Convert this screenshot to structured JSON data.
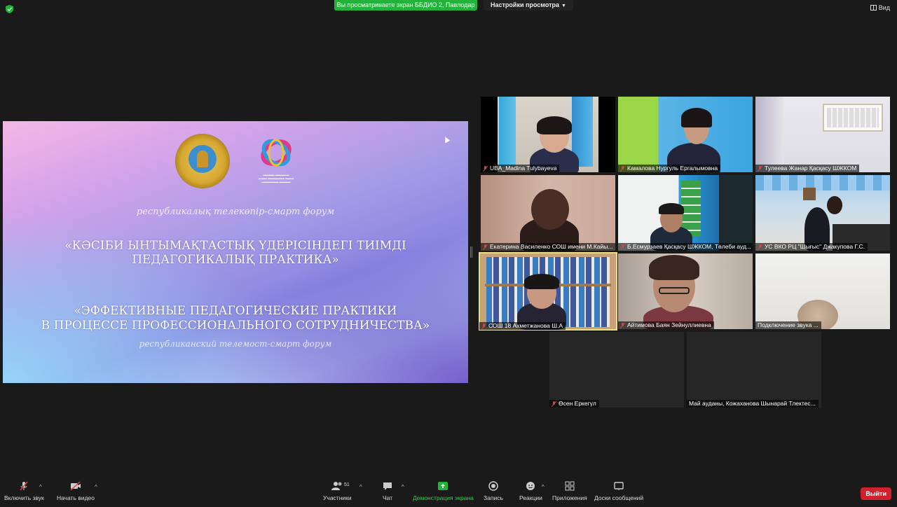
{
  "top": {
    "share_banner": "Вы просматриваете экран ББДИО 2, Павлодар",
    "view_settings": "Настройки просмотра",
    "view_toggle": "Вид"
  },
  "slide": {
    "kz_subtitle": "республикалық телекөпір-смарт форум",
    "kz_title_line1": "«КӘСІБИ ЫНТЫМАҚТАСТЫҚ ҮДЕРІСІНДЕГІ ТИІМДІ",
    "kz_title_line2": "ПЕДАГОГИКАЛЫҚ ПРАКТИКА»",
    "ru_title_line1": "«ЭФФЕКТИВНЫЕ ПЕДАГОГИЧЕСКИЕ ПРАКТИКИ",
    "ru_title_line2": "В ПРОЦЕССЕ ПРОФЕССИОНАЛЬНОГО СОТРУДНИЧЕСТВА»",
    "ru_subtitle": "республиканский телемост-смарт форум"
  },
  "participants": [
    {
      "name": "UBA_Madina Tulybayeva",
      "muted": true
    },
    {
      "name": "Камалова Нургуль Ергалымовна",
      "muted": true
    },
    {
      "name": "Тулеева Жанар Қасқасу ШЖКОМ",
      "muted": true
    },
    {
      "name": "Екатерина Василенко СОШ имени М.Кайы...",
      "muted": true
    },
    {
      "name": "Б.Есмурзаев Қасқасу ШЖКОМ, Төлеби ауд...",
      "muted": true
    },
    {
      "name": "УС ВКО РЦ \"Шығыс\" Джакупова Г.С.",
      "muted": true
    },
    {
      "name": "СОШ 18 Ахметжанова Ш.А",
      "muted": true
    },
    {
      "name": "Айтимова Баян Зейнуллиевна",
      "muted": true
    },
    {
      "name": "Подключение звука ...",
      "muted": false
    },
    {
      "name": "Өсен Еркегүл",
      "muted": true
    },
    {
      "name": "Май ауданы, Кожаханова Шынарай Тлектес...",
      "muted": false
    }
  ],
  "toolbar": {
    "unmute": "Включить звук",
    "start_video": "Начать видео",
    "participants": "Участники",
    "participants_count": "51",
    "chat": "Чат",
    "share_screen": "Демонстрация экрана",
    "record": "Запись",
    "reactions": "Реакции",
    "apps": "Приложения",
    "whiteboards": "Доски сообщений",
    "leave": "Выйти"
  },
  "colors": {
    "share_green": "#23b33a",
    "leave_red": "#d0222c",
    "active_speaker": "#e8e07a",
    "muted_red": "#e04040"
  }
}
